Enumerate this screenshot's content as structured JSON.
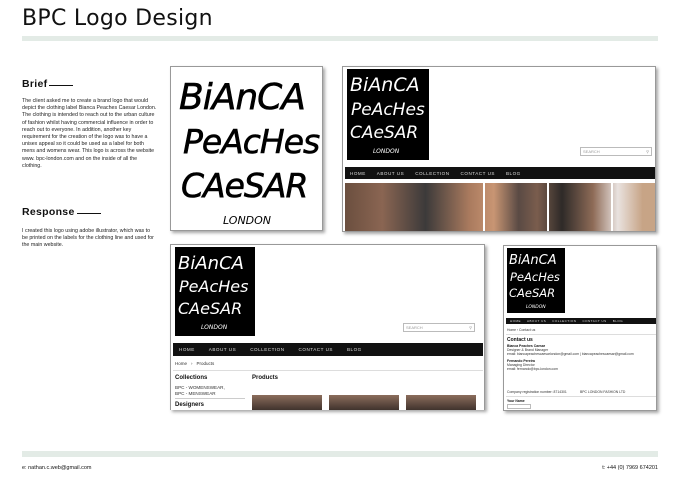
{
  "page": {
    "title": "BPC Logo Design",
    "brief_heading": "Brief",
    "brief_text": "The client asked me to create a brand logo that would depict the clothing label Bianca Peaches Caesar London. The clothing is intended to reach out to the urban culture of fashion whilst having commercial influence in order to reach out to everyone. In addition, another key requirement for the creation of the logo was to have a unisex appeal so it could be used as a label for both mens and womens wear. This logo is across the website www. bpc-london.com and on the inside of all the clothing.",
    "response_heading": "Response",
    "response_text": "I created this logo using adobe illustrator, which was to be printed on the labels for the clothing line and used for the main website.",
    "footer_email": "e: nathan.c.web@gmail.com",
    "footer_phone": "t: +44 (0) 7969 674201"
  },
  "logo": {
    "lines": [
      "BiAnCA",
      "PeAcHes",
      "CAeSAR"
    ],
    "sub": "LONDON"
  },
  "site1": {
    "search_placeholder": "SEARCH",
    "nav": [
      "HOME",
      "ABOUT US",
      "COLLECTION",
      "CONTACT US",
      "BLOG"
    ]
  },
  "site2": {
    "search_placeholder": "SEARCH",
    "nav": [
      "HOME",
      "ABOUT US",
      "COLLECTION",
      "CONTACT US",
      "BLOG"
    ],
    "breadcrumb": [
      "Home",
      "Products"
    ],
    "collections_heading": "Collections",
    "collections": [
      "BPC - WOMENSWEAR,",
      "BPC - MENSWEAR"
    ],
    "designers_heading": "Designers",
    "products_heading": "Products"
  },
  "site3": {
    "nav": [
      "HOME",
      "ABOUT US",
      "COLLECTION",
      "CONTACT US",
      "BLOG"
    ],
    "breadcrumb": "Home  ›  Contact us",
    "contact_heading": "Contact us",
    "name1": "Bianca Peaches Caesar",
    "role1": "Designer & Brand Manager",
    "email1": "email: biancapeachescaesarlondon@gmail.com  |  biancapeachescaesar@gmail.com",
    "name2": "Fernando Pereira",
    "role2": "Managing Director",
    "email2": "email: fernando@bpc-london.com",
    "company_reg": "Company registration number: 8714301",
    "company_name": "BPC LONDON FASHION LTD",
    "form_label": "Your Name"
  }
}
